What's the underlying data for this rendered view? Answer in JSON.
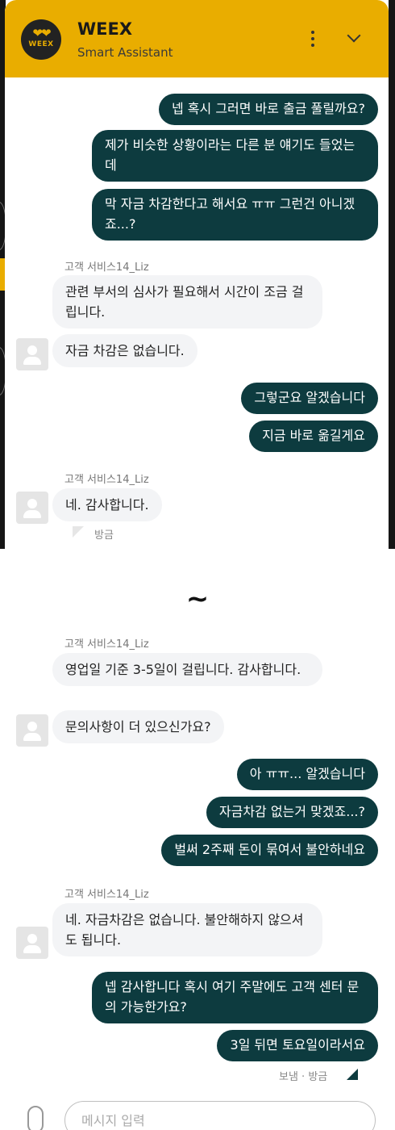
{
  "header": {
    "logo_text": "WEEX",
    "title": "WEEX",
    "subtitle": "Smart Assistant"
  },
  "colors": {
    "brand": "#e9ad00",
    "outgoing_bubble": "#0d3b3f",
    "incoming_bubble": "#f3f4f6"
  },
  "icons": [
    "more-vertical-icon",
    "chevron-down-icon",
    "user-avatar-icon",
    "paperclip-icon"
  ],
  "chat_top": {
    "msg_1": "넵 혹시 그러면 바로 출금 풀릴까요?",
    "msg_2": "제가 비슷한 상황이라는 다른 분 얘기도 들었는데",
    "msg_3": "막 자금 차감한다고 해서요 ㅠㅠ 그런건 아니겠죠...?",
    "agent_1": "고객 서비스14_Liz",
    "msg_4": "관련 부서의 심사가 필요해서 시간이 조금 걸립니다.",
    "msg_5": "자금 차감은 없습니다.",
    "msg_6": "그렇군요 알겠습니다",
    "msg_7": "지금 바로 옮길게요",
    "agent_2": "고객 서비스14_Liz",
    "msg_8": "네. 감사합니다.",
    "time_1": "방금"
  },
  "separator": "~",
  "chat_bottom": {
    "agent_1": "고객 서비스14_Liz",
    "msg_1": "영업일 기준 3-5일이 걸립니다. 감사합니다.",
    "msg_2": "문의사항이 더 있으신가요?",
    "msg_3": "아 ㅠㅠ... 알겠습니다",
    "msg_4": "자금차감 없는거 맞겠죠...?",
    "msg_5": "벌써 2주째 돈이 묶여서 불안하네요",
    "agent_2": "고객 서비스14_Liz",
    "msg_6": "네. 자금차감은 없습니다. 불안해하지 않으셔도 됩니다.",
    "msg_7": "넵 감사합니다 혹시 여기 주말에도 고객 센터 문의 가능한가요?",
    "msg_8": "3일 뒤면 토요일이라서요",
    "status": "보냄 · 방금"
  },
  "input": {
    "placeholder": "메시지 입력"
  }
}
